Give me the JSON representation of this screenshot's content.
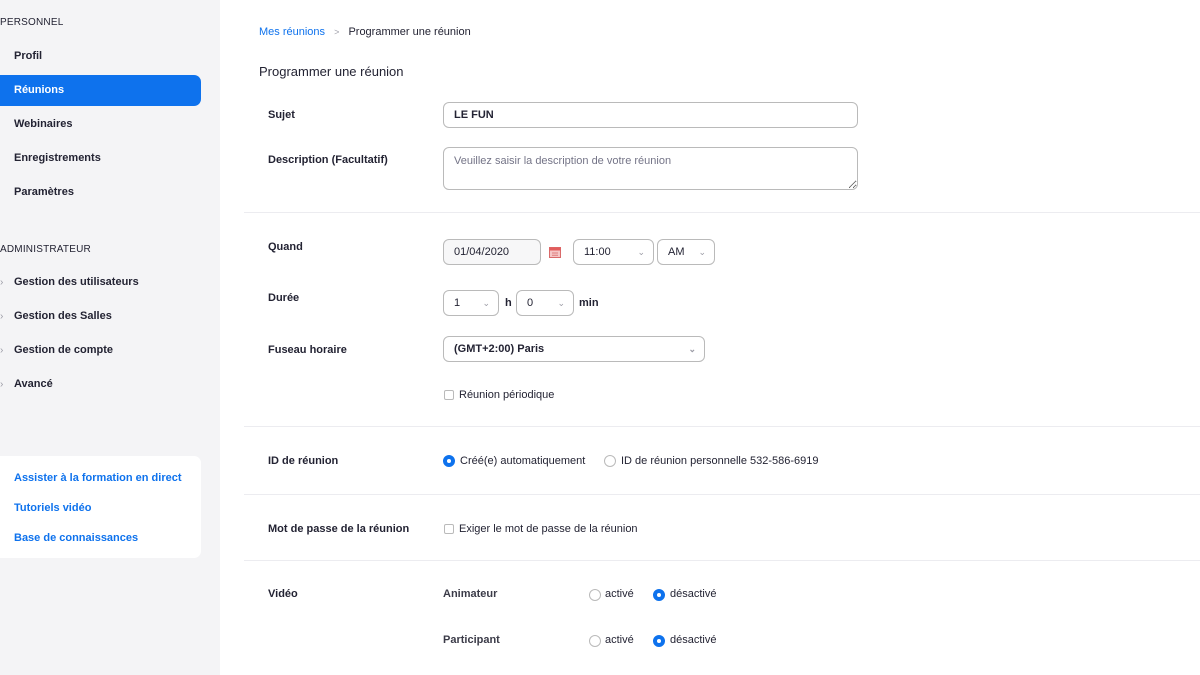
{
  "sidebar": {
    "personal_title": "PERSONNEL",
    "items": [
      {
        "label": "Profil"
      },
      {
        "label": "Réunions"
      },
      {
        "label": "Webinaires"
      },
      {
        "label": "Enregistrements"
      },
      {
        "label": "Paramètres"
      }
    ],
    "admin_title": "ADMINISTRATEUR",
    "admin_items": [
      {
        "label": "Gestion des utilisateurs"
      },
      {
        "label": "Gestion des Salles"
      },
      {
        "label": "Gestion de compte"
      },
      {
        "label": "Avancé"
      }
    ],
    "help_links": [
      {
        "label": "Assister à la formation en direct"
      },
      {
        "label": "Tutoriels vidéo"
      },
      {
        "label": "Base de connaissances"
      }
    ]
  },
  "breadcrumb": {
    "parent": "Mes réunions",
    "separator": ">",
    "current": "Programmer une réunion"
  },
  "page_title": "Programmer une réunion",
  "form": {
    "topic_label": "Sujet",
    "topic_value": "LE FUN",
    "description_label": "Description (Facultatif)",
    "description_placeholder": "Veuillez saisir la description de votre réunion",
    "when_label": "Quand",
    "date_value": "01/04/2020",
    "time_value": "11:00",
    "ampm_value": "AM",
    "duration_label": "Durée",
    "duration_hours": "1",
    "hours_unit": "h",
    "duration_minutes": "0",
    "minutes_unit": "min",
    "timezone_label": "Fuseau horaire",
    "timezone_value": "(GMT+2:00) Paris",
    "recurring_label": "Réunion périodique",
    "meeting_id_label": "ID de réunion",
    "meeting_id_auto": "Créé(e) automatiquement",
    "meeting_id_personal": "ID de réunion personnelle 532-586-6919",
    "password_label": "Mot de passe de la réunion",
    "password_checkbox": "Exiger le mot de passe de la réunion",
    "video_label": "Vidéo",
    "host_label": "Animateur",
    "participant_label": "Participant",
    "on_label": "activé",
    "off_label": "désactivé"
  },
  "colors": {
    "accent": "#0e72ed",
    "sidebar_bg": "#f4f4f6"
  }
}
